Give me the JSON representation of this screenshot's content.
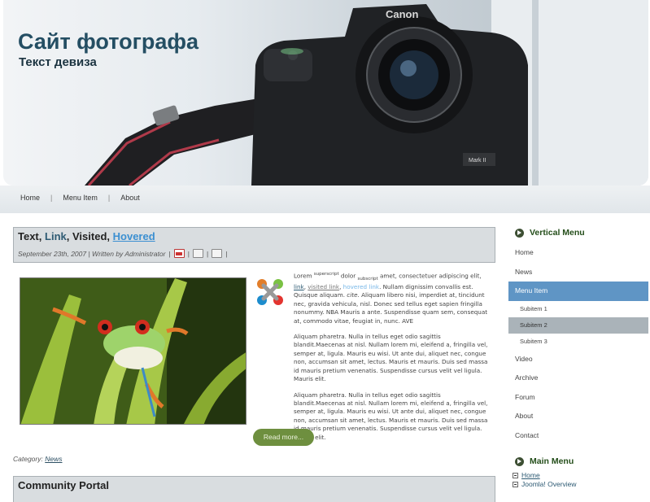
{
  "header": {
    "site_title": "Сайт фотографа",
    "slogan": "Текст девиза"
  },
  "topnav": {
    "items": [
      "Home",
      "Menu Item",
      "About"
    ],
    "separator": "|"
  },
  "article": {
    "title_prefix": "Text,",
    "title_link": "Link",
    "title_sep1": ",",
    "title_visited": "Visited,",
    "title_hovered": "Hovered",
    "meta": "September 23th, 2007 | Written by Administrator",
    "meta_sep": "|",
    "p1_lorem": "Lorem",
    "p1_sup": "superscript",
    "p1_dolor": "dolor",
    "p1_sub": "subscript",
    "p1_rest": "amet, consectetuer adipiscing elit,",
    "p1_link": "link",
    "p1_visited": "visited link",
    "p1_hovered": "hovered link",
    "p1_after": ". Nullam dignissim convallis est. Quisque aliquam.",
    "p1_cite": "cite",
    "p1_tail": ". Aliquam libero nisi, imperdiet at, tincidunt nec, gravida vehicula, nisl. Donec sed tellus eget sapien fringilla nonummy. NBA Mauris a ante. Suspendisse quam sem, consequat at, commodo vitae, feugiat in, nunc. AVE",
    "p2": "Aliquam pharetra. Nulla in tellus eget odio sagittis blandit.Maecenas at nisl. Nullam lorem mi, eleifend a, fringilla vel, semper at, ligula. Mauris eu wisi. Ut ante dui, aliquet nec, congue non, accumsan sit amet, lectus. Mauris et mauris. Duis sed massa id mauris pretium venenatis. Suspendisse cursus velit vel ligula. Mauris elit.",
    "p3": "Aliquam pharetra. Nulla in tellus eget odio sagittis blandit.Maecenas at nisl. Nullam lorem mi, eleifend a, fringilla vel, semper at, ligula. Mauris eu wisi. Ut ante dui, aliquet nec, congue non, accumsan sit amet, lectus. Mauris et mauris. Duis sed massa id mauris pretium venenatis. Suspendisse cursus velit vel ligula. Mauris elit.",
    "read_more": "Read more...",
    "category_label": "Category:",
    "category_value": "News"
  },
  "portal": {
    "title": "Community Portal"
  },
  "vertical_menu": {
    "title": "Vertical Menu",
    "items": [
      "Home",
      "News",
      "Menu Item",
      "Subitem 1",
      "Subitem 2",
      "Subitem 3",
      "Video",
      "Archive",
      "Forum",
      "About",
      "Contact"
    ]
  },
  "main_menu": {
    "title": "Main Menu",
    "items": [
      "Home",
      "Joomla! Overview"
    ]
  },
  "colors": {
    "title_color": "#244e63",
    "active_menu": "#5f95c5",
    "read_more_bg": "#6e8f3f",
    "article_head_bg": "#d9dde0"
  }
}
